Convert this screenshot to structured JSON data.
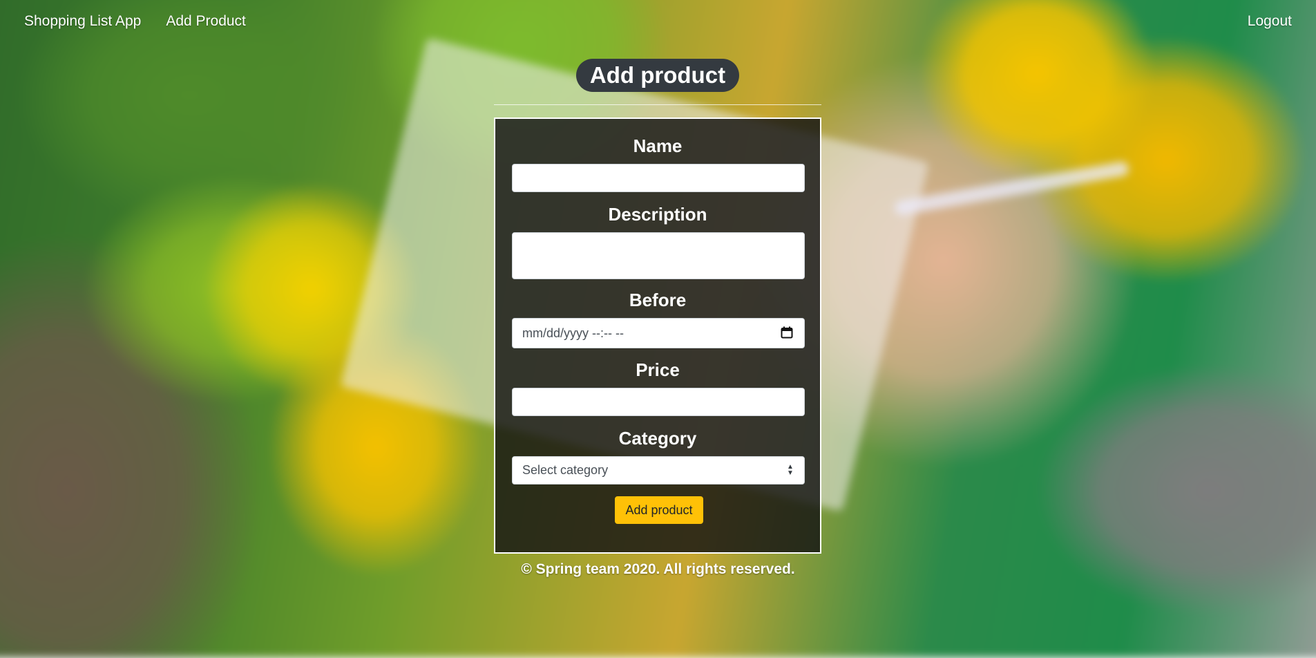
{
  "nav": {
    "brand": "Shopping List App",
    "add_product": "Add Product",
    "logout": "Logout"
  },
  "page": {
    "title": "Add product"
  },
  "form": {
    "name_label": "Name",
    "description_label": "Description",
    "before_label": "Before",
    "before_placeholder": "mm/dd/yyyy --:-- --",
    "price_label": "Price",
    "category_label": "Category",
    "category_selected": "Select category",
    "submit_label": "Add product"
  },
  "footer": {
    "text": "© Spring team 2020. All rights reserved."
  },
  "colors": {
    "accent": "#ffc107",
    "title_pill": "#343a40",
    "panel": "#141414"
  }
}
